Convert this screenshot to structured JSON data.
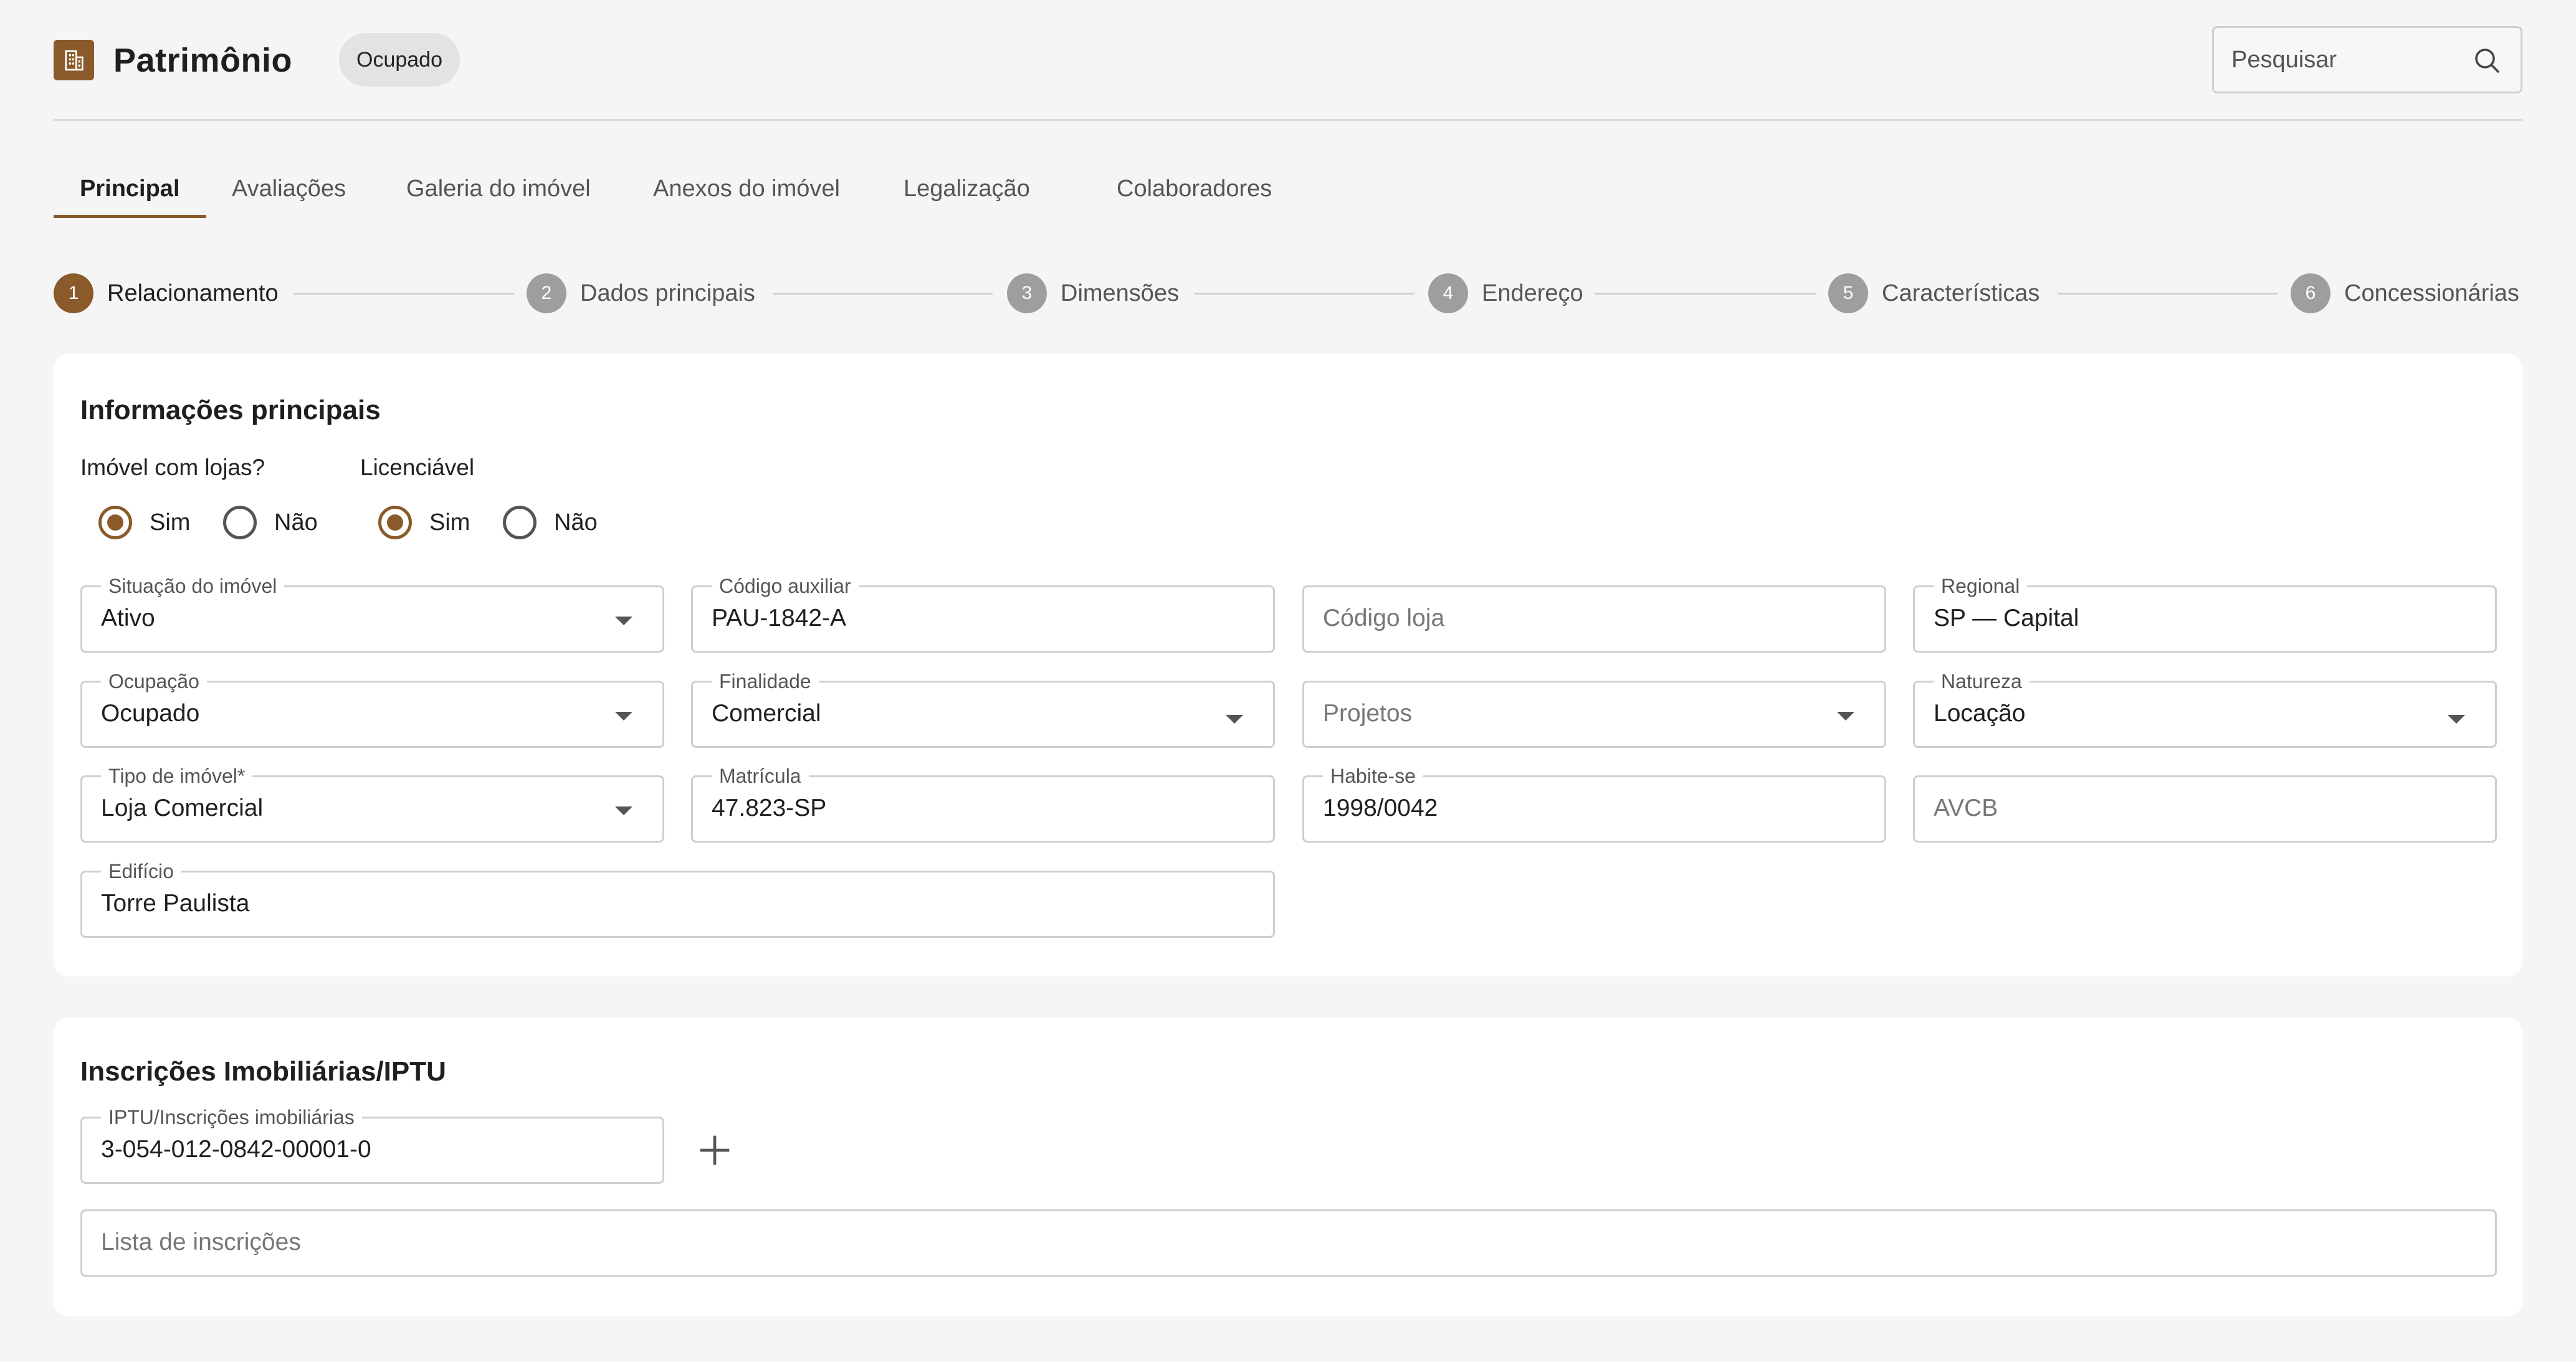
{
  "app": {
    "title": "Patrimônio",
    "status_chip": "Ocupado",
    "search_placeholder": "Pesquisar"
  },
  "tabs": [
    {
      "label": "Principal",
      "active": true
    },
    {
      "label": "Avaliações"
    },
    {
      "label": "Galeria do imóvel"
    },
    {
      "label": "Anexos do imóvel"
    },
    {
      "label": "Legalização"
    },
    {
      "label": "Colaboradores"
    }
  ],
  "stepper": [
    {
      "num": "1",
      "label": "Relacionamento",
      "active": true
    },
    {
      "num": "2",
      "label": "Dados principais"
    },
    {
      "num": "3",
      "label": "Dimensões"
    },
    {
      "num": "4",
      "label": "Endereço"
    },
    {
      "num": "5",
      "label": "Características"
    },
    {
      "num": "6",
      "label": "Concessionárias"
    }
  ],
  "info": {
    "title": "Informações principais",
    "lojas": {
      "label": "Imóvel com lojas?",
      "yes": "Sim",
      "no": "Não",
      "selected": "Sim"
    },
    "licenciavel": {
      "label": "Licenciável",
      "yes": "Sim",
      "no": "Não",
      "selected": "Sim"
    },
    "fields": {
      "situacao": {
        "label": "Situação do imóvel",
        "value": "Ativo"
      },
      "codigo_auxiliar": {
        "label": "Código auxiliar",
        "value": "PAU-1842-A"
      },
      "codigo_loja": {
        "placeholder": "Código loja"
      },
      "regional": {
        "label": "Regional",
        "value": "SP — Capital"
      },
      "ocupacao": {
        "label": "Ocupação",
        "value": "Ocupado"
      },
      "finalidade": {
        "label": "Finalidade",
        "value": "Comercial"
      },
      "projetos": {
        "placeholder": "Projetos"
      },
      "natureza": {
        "label": "Natureza",
        "value": "Locação"
      },
      "tipo": {
        "label": "Tipo de imóvel*",
        "value": "Loja Comercial"
      },
      "matricula": {
        "label": "Matrícula",
        "value": "47.823-SP"
      },
      "habite_se": {
        "label": "Habite-se",
        "value": "1998/0042"
      },
      "avcb": {
        "placeholder": "AVCB"
      },
      "edificio": {
        "label": "Edifício",
        "value": "Torre Paulista"
      }
    }
  },
  "iptu": {
    "title": "Inscrições Imobiliárias/IPTU",
    "field": {
      "label": "IPTU/Inscrições imobiliárias",
      "value": "3-054-012-0842-00001-0"
    },
    "list_placeholder": "Lista de inscrições"
  },
  "colors": {
    "accent": "#8a5a2b",
    "inactive_step": "#9e9e9e",
    "background": "#f5f5f5"
  },
  "icons": {
    "logo": "building-icon",
    "search": "search-icon",
    "add": "plus-icon",
    "dropdown": "caret-down-icon"
  }
}
